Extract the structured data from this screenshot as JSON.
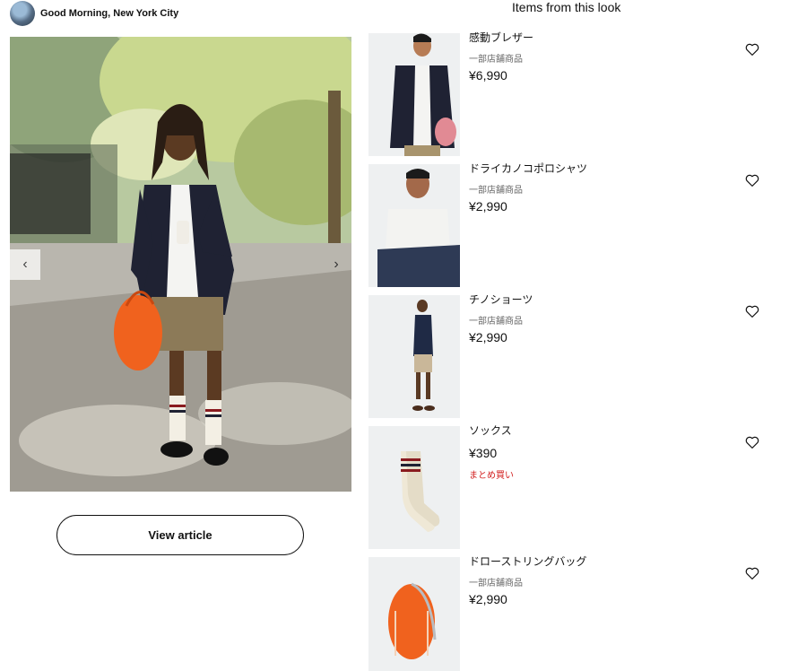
{
  "header": {
    "author_name": "Good Morning, New York City",
    "section_title": "Items from this look"
  },
  "hero": {
    "prev_icon": "‹",
    "next_icon": "›"
  },
  "view_article_label": "View article",
  "products": [
    {
      "name": "感動ブレザー",
      "availability": "一部店舗商品",
      "price": "¥6,990",
      "promo": ""
    },
    {
      "name": "ドライカノコポロシャツ",
      "availability": "一部店舗商品",
      "price": "¥2,990",
      "promo": ""
    },
    {
      "name": "チノショーツ",
      "availability": "一部店舗商品",
      "price": "¥2,990",
      "promo": ""
    },
    {
      "name": "ソックス",
      "availability": "",
      "price": "¥390",
      "promo": "まとめ買い"
    },
    {
      "name": "ドローストリングバッグ",
      "availability": "一部店舗商品",
      "price": "¥2,990",
      "promo": ""
    }
  ],
  "colors": {
    "promo": "#d21f1f",
    "bag_orange": "#f0621e",
    "blazer_navy": "#1f2233"
  }
}
